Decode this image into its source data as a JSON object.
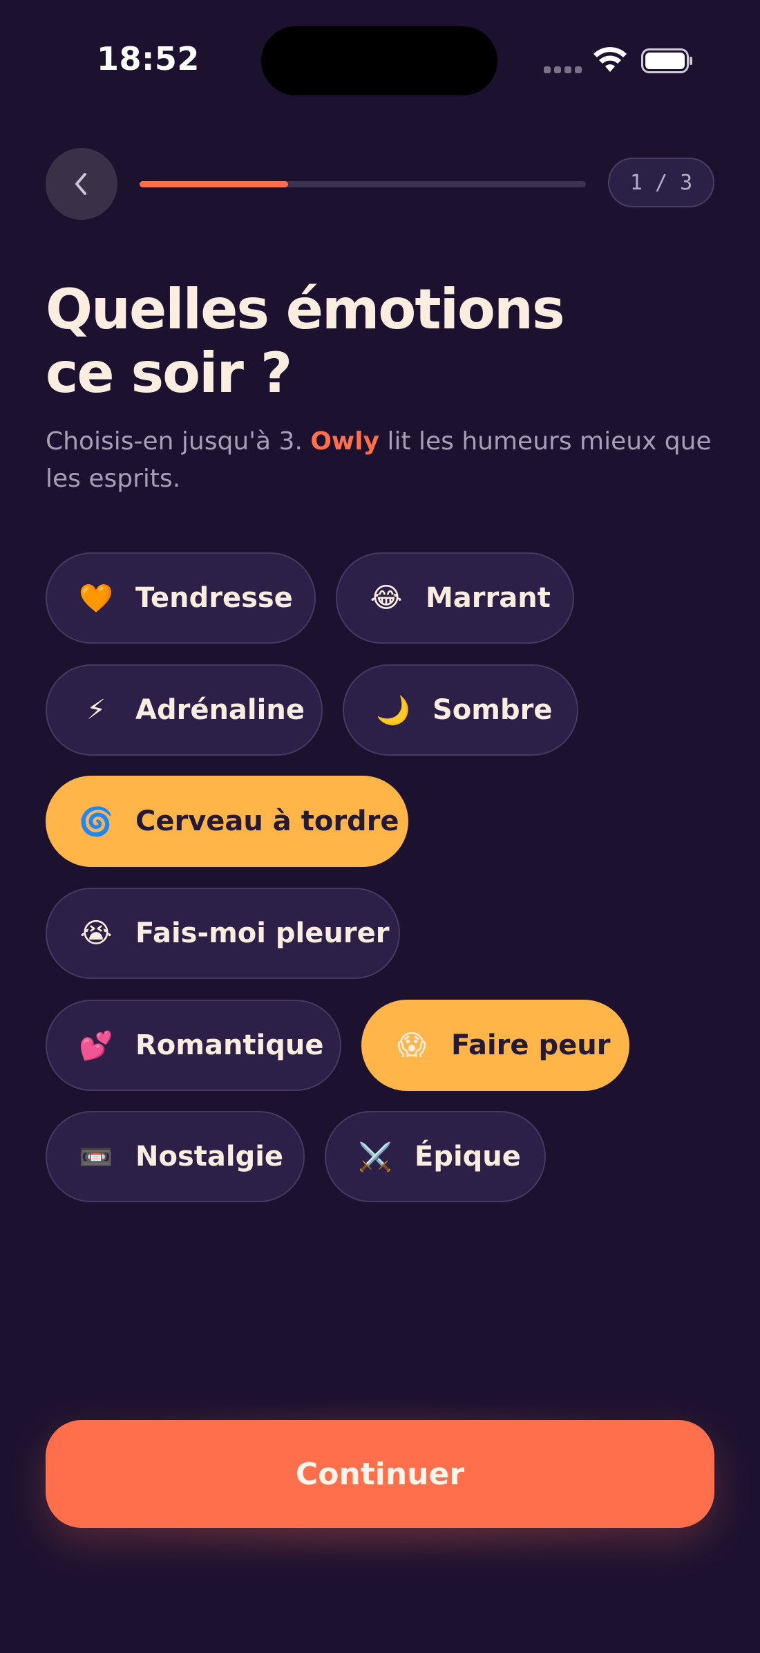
{
  "status_bar": {
    "time": "18:52"
  },
  "header": {
    "back_icon": "chevron-left-icon",
    "progress_value": 0.333,
    "step_indicator": "1 / 3"
  },
  "title": {
    "line1": "Quelles émotions",
    "line2": "ce soir ?"
  },
  "subtitle": {
    "before": "Choisis-en jusqu'à 3. ",
    "highlight": "Owly",
    "after": " lit les humeurs mieux que les esprits."
  },
  "chips": [
    {
      "emoji": "🧡",
      "label": "Tendresse",
      "selected": false
    },
    {
      "emoji": "😂",
      "label": "Marrant",
      "selected": false
    },
    {
      "emoji": "⚡",
      "label": "Adrénaline",
      "selected": false
    },
    {
      "emoji": "🌙",
      "label": "Sombre",
      "selected": false
    },
    {
      "emoji": "🌀",
      "label": "Cerveau à tordre",
      "selected": true
    },
    {
      "emoji": "😭",
      "label": "Fais-moi pleurer",
      "selected": false
    },
    {
      "emoji": "💕",
      "label": "Romantique",
      "selected": false
    },
    {
      "emoji": "😱",
      "label": "Faire peur",
      "selected": true
    },
    {
      "emoji": "📼",
      "label": "Nostalgie",
      "selected": false
    },
    {
      "emoji": "⚔️",
      "label": "Épique",
      "selected": false
    }
  ],
  "cta": {
    "label": "Continuer"
  },
  "colors": {
    "background": "#1c1230",
    "accent": "#ff6f4b",
    "selected_chip": "#ffb547",
    "chip": "#2c2049",
    "text": "#fbeee0"
  }
}
